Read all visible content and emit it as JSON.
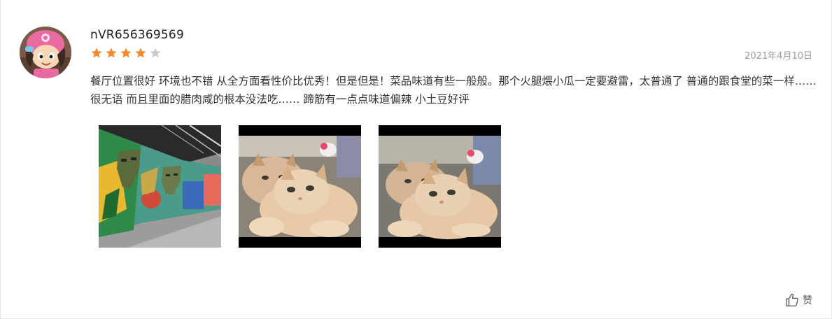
{
  "review": {
    "username": "nVR656369569",
    "rating": 4,
    "rating_max": 5,
    "date": "2021年4月10日",
    "text": "餐厅位置很好 环境也不错 从全方面看性价比优秀！但是但是！菜品味道有些一般般。那个火腿煨小瓜一定要避雷，太普通了 普通的跟食堂的菜一样……很无语 而且里面的腊肉咸的根本没法吃…… 蹄筋有一点点味道偏辣 小土豆好评",
    "photos": [
      {
        "name": "photo-mural-corridor"
      },
      {
        "name": "photo-cat-1"
      },
      {
        "name": "photo-cat-2"
      }
    ],
    "like_label": "赞"
  },
  "colors": {
    "star_on": "#f78a2c",
    "star_off": "#cccccc",
    "text": "#333333",
    "date": "#999999"
  }
}
